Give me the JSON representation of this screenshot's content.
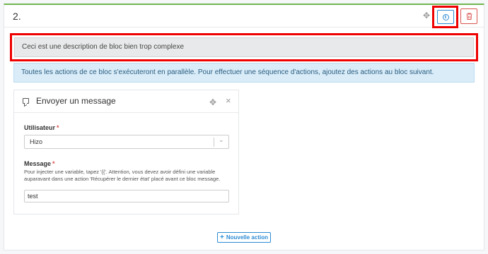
{
  "block": {
    "number": "2.",
    "description": "Ceci est une description de bloc bien trop complexe",
    "info_text": "Toutes les actions de ce bloc s'exécuteront en parallèle. Pour effectuer une séquence d'actions, ajoutez des actions au bloc suivant."
  },
  "icons": {
    "move": "move-arrows",
    "info": "info-circle",
    "delete": "trash",
    "message": "message-bubble",
    "close": "close-x",
    "chevron": "chevron-down",
    "plus": "plus"
  },
  "action": {
    "title": "Envoyer un message",
    "user_field": {
      "label": "Utilisateur",
      "required": "*",
      "value": "Hizo"
    },
    "message_field": {
      "label": "Message",
      "required": "*",
      "help": "Pour injecter une variable, tapez '{{'. Attention, vous devez avoir défini une variable auparavant dans une action 'Récupérer le dernier état' placé avant ce bloc message.",
      "value": "test"
    }
  },
  "footer": {
    "add_action_label": "Nouvelle action"
  },
  "colors": {
    "accent": "#2d8bd4",
    "danger": "#d9534f",
    "success_border": "#6fb650",
    "highlight": "#ee0000",
    "info_bg": "#d9ecf8"
  }
}
